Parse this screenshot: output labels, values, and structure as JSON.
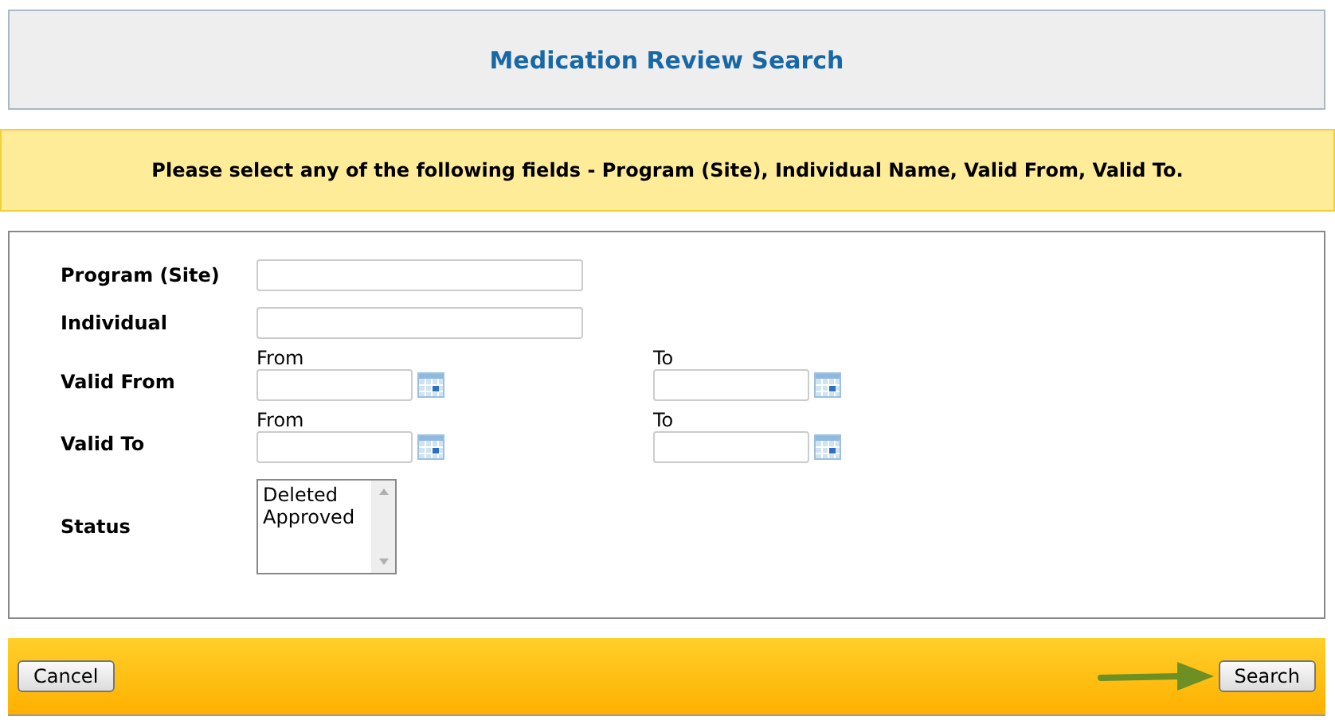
{
  "header": {
    "title": "Medication Review Search"
  },
  "instruction": "Please select any of the following fields - Program (Site), Individual Name, Valid From, Valid To.",
  "fields": [
    {
      "kind": "text",
      "label": "Program (Site)"
    },
    {
      "kind": "text",
      "label": "Individual"
    },
    {
      "kind": "date_range",
      "label": "Valid From",
      "from_label": "From",
      "to_label": "To"
    },
    {
      "kind": "date_range",
      "label": "Valid To",
      "from_label": "From",
      "to_label": "To"
    },
    {
      "kind": "listbox",
      "label": "Status",
      "options": [
        "Deleted",
        "Approved"
      ]
    }
  ],
  "footer": {
    "buttons": [
      {
        "kind": "cancel",
        "label": "Cancel"
      },
      {
        "kind": "search",
        "label": "Search"
      }
    ]
  }
}
